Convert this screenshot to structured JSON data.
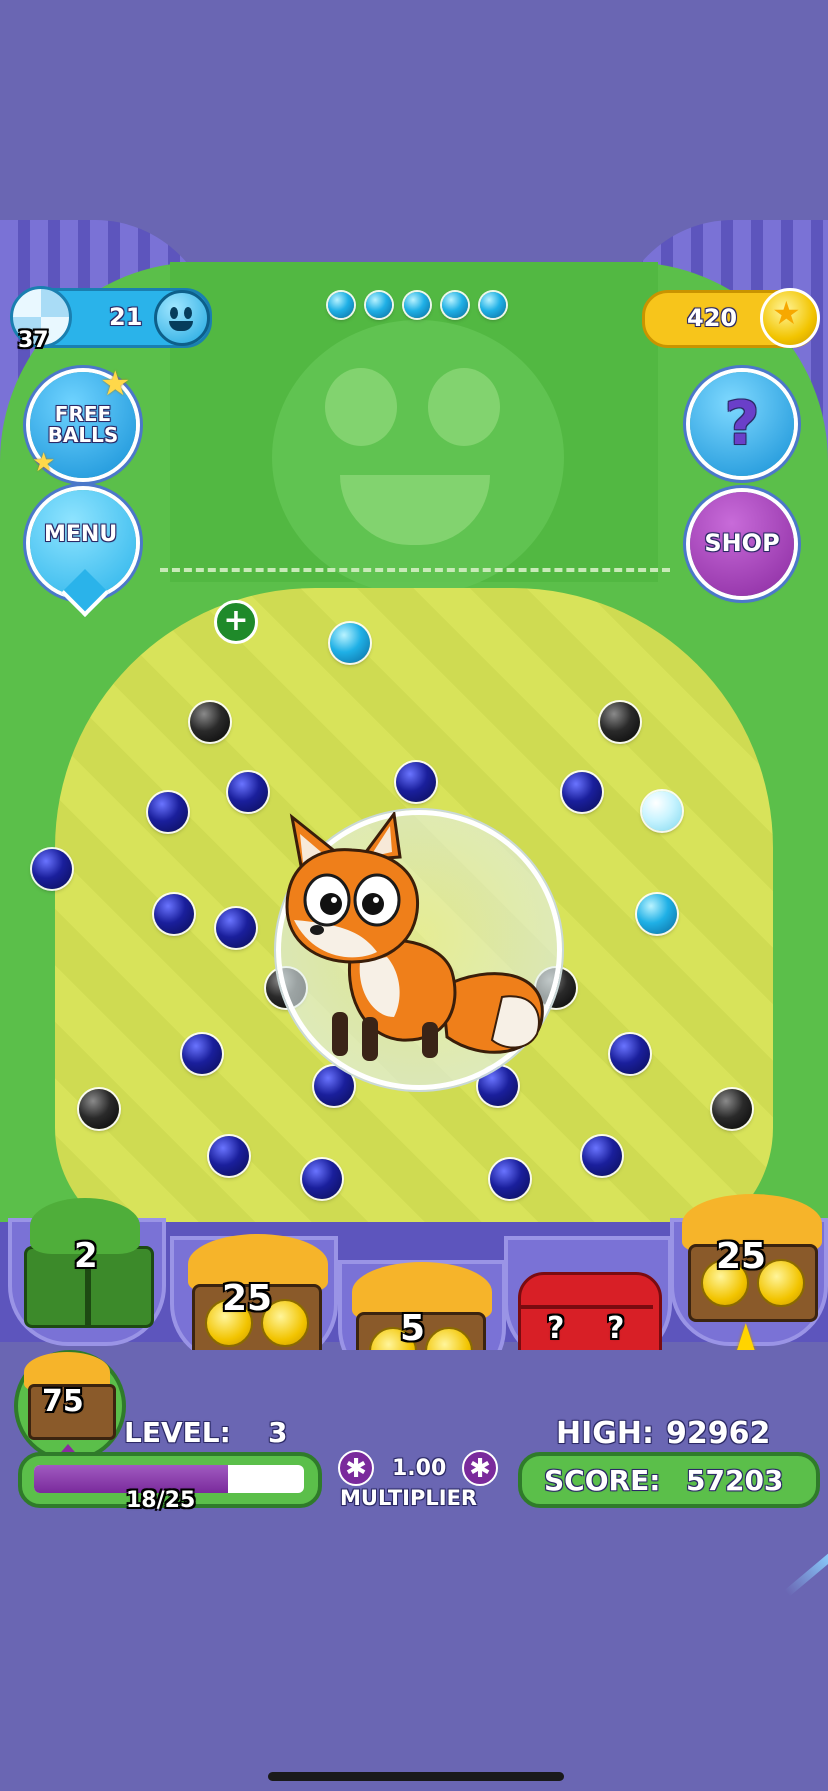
{
  "top_bar": {
    "balls_count": "21",
    "ball_wheel_count": "37",
    "coins": "420",
    "shot_indicators": 5
  },
  "left_buttons": {
    "free_balls_line1": "FREE",
    "free_balls_line2": "BALLS",
    "menu": "MENU"
  },
  "right_buttons": {
    "help": "?",
    "shop": "SHOP"
  },
  "buckets": [
    {
      "kind": "puzzle",
      "value": "2"
    },
    {
      "kind": "coins",
      "value": "25"
    },
    {
      "kind": "coins",
      "value": "5"
    },
    {
      "kind": "mystery-chest",
      "value": "?"
    },
    {
      "kind": "coins",
      "value": "25"
    }
  ],
  "reward_badge": {
    "value": "75"
  },
  "level": {
    "label": "LEVEL:",
    "value": "3"
  },
  "progress": {
    "text": "18/25",
    "current": 18,
    "total": 25
  },
  "multiplier": {
    "value": "1.00",
    "label": "MULTIPLIER"
  },
  "high": {
    "label": "HIGH:",
    "value": "92962"
  },
  "score": {
    "label": "SCORE:",
    "value": "57203"
  },
  "colors": {
    "background": "#6a66b3",
    "board_green": "#5bbf4a",
    "board_yellow": "#d8e35a",
    "coin_badge": "#f7c51b",
    "balls_badge": "#2ab3ea",
    "shop_purple": "#8a2aa0"
  }
}
